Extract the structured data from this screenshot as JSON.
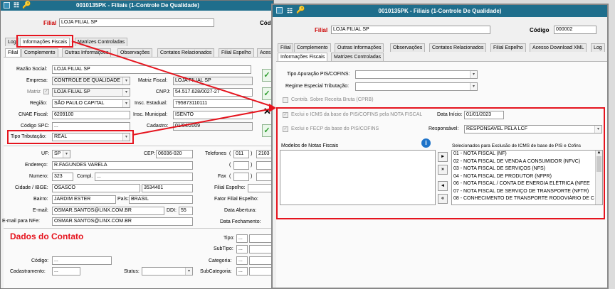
{
  "back": {
    "title": "0010135PK - Filiais (1-Controle De Qualidade)",
    "filial_label": "Filial",
    "filial_value": "LOJA FILIAL SP",
    "codigo_label_partial": "Cód",
    "tabs_row1": [
      "Log",
      "Informações Fiscais",
      "Matrizes Controladas"
    ],
    "tabs_row2": [
      "Filial",
      "Complemento",
      "Outras Informações",
      "Observações",
      "Contatos Relacionados",
      "Filial Espelho",
      "Aces"
    ],
    "razao_label": "Razão Social:",
    "razao_value": "LOJA FILIAL SP",
    "empresa_label": "Empresa:",
    "empresa_value": "CONTROLE DE QUALIDADE",
    "matriz_fiscal_label": "Matriz Fiscal:",
    "matriz_fiscal_value": "LOJA FILIAL SP",
    "matriz_label": "Matriz",
    "matriz_value": "LOJA FILIAL SP",
    "cnpj_label": "CNPJ:",
    "cnpj_value": "54.517.628/0027-27",
    "regiao_label": "Região:",
    "regiao_value": "SÃO PAULO CAPITAL",
    "insc_est_label": "Insc. Estadual:",
    "insc_est_value": "795873110111",
    "cnae_label": "CNAE Fiscal:",
    "cnae_value": "6209100",
    "insc_mun_label": "Insc. Municipal:",
    "insc_mun_value": "ISENTO",
    "spc_label": "Código SPC:",
    "spc_value": "...",
    "cadastro_label": "Cadastro:",
    "cadastro_value": "01/04/2009",
    "tipo_trib_label": "Tipo Tributação:",
    "tipo_trib_value": "REAL",
    "uf_label": "UF:",
    "uf_value": "SP",
    "cep_label": "CEP:",
    "cep_value": "06036-020",
    "telefones_label": "Telefones",
    "tel_ddd": "011",
    "tel_num": "2103",
    "endereco_label": "Endereço:",
    "endereco_value": "R.FAGUNDES VARELA",
    "numero_label": "Numero:",
    "numero_value": "323",
    "compl_label": "Compl.",
    "compl_value": "...",
    "fax_label": "Fax",
    "cidade_label": "Cidade / IBGE:",
    "cidade_value": "OSASCO",
    "ibge_value": "3534401",
    "filial_espelho_label": "Filial Espelho:",
    "bairro_label": "Bairro:",
    "bairro_value": "JARDIM ESTER",
    "pais_label": "País:",
    "pais_value": "BRASIL",
    "fator_label": "Fator Filial Espelho:",
    "email_label": "E-mail:",
    "email_value": "OSMAR.SANTOS@LINX.COM.BR",
    "ddi_label": "DDI:",
    "ddi_value": "55",
    "abertura_label": "Data Abertura:",
    "email_nfe_label": "E-mail para NFe:",
    "email_nfe_value": "OSMAR.SANTOS@LINX.COM.BR",
    "fechamento_label": "Data Fechamento:",
    "dados_contato": "Dados do Contato",
    "tipo_label": "Tipo:",
    "subtipo_label": "SubTipo:",
    "codigo_label": "Código:",
    "categoria_label": "Categoria:",
    "cadastramento_label": "Cadastramento:",
    "status_label": "Status:",
    "subcategoria_label": "SubCategoria:",
    "dots": "..."
  },
  "front": {
    "title": "0010135PK - Filiais (1-Controle De Qualidade)",
    "filial_label": "Filial",
    "filial_value": "LOJA FILIAL SP",
    "codigo_label": "Código",
    "codigo_value": "000002",
    "tabs_row1": [
      "Filial",
      "Complemento",
      "Outras Informações",
      "Observações",
      "Contatos Relacionados",
      "Filial Espelho",
      "Acesso Download XML",
      "Log"
    ],
    "tabs_row2": [
      "Informações Fiscais",
      "Matrizes Controladas"
    ],
    "tipo_apuracao_label": "Tipo Apuração PIS/COFINS:",
    "regime_label": "Regime Especial Tributação:",
    "contrib_label": "Contrib. Sobre Receita Bruta (CPRB)",
    "exclui_icms_label": "Exclui o ICMS da base do PIS/COFINS pela NOTA FISCAL",
    "data_inicio_label": "Data Início:",
    "data_inicio_value": "01/01/2023",
    "exclui_fecp_label": "Exclui o FECP da base do PIS/COFINS",
    "responsavel_label": "Responsável:",
    "responsavel_value": "RESPONSAVEL PELA LCF",
    "modelos_label": "Modelos de Notas Fiscais",
    "selecionados_label": "Selecionados para Exclusão de ICMS de base de PIS e Cofins",
    "move_buttons": [
      "▸",
      "»",
      "◂",
      "«"
    ],
    "selected_items": [
      "01 - NOTA FISCAL (NF)",
      "02 - NOTA FISCAL DE VENDA A CONSUMIDOR (NFVC)",
      "03 - NOTA FISCAL DE SERVIÇOS (NFS)",
      "04 - NOTA FISCAL DE PRODUTOR (NFPR)",
      "06 - NOTA FISCAL / CONTA DE ENERGIA ELÉTRICA (NFEE",
      "07 - NOTA FISCAL DE SERVIÇO DE TRANSPORTE (NFTR)",
      "08 - CONHECIMENTO DE TRANSPORTE RODOVIÁRIO DE C"
    ]
  },
  "colors": {
    "title_bar": "#1f6e8c",
    "highlight": "#e5141e"
  }
}
